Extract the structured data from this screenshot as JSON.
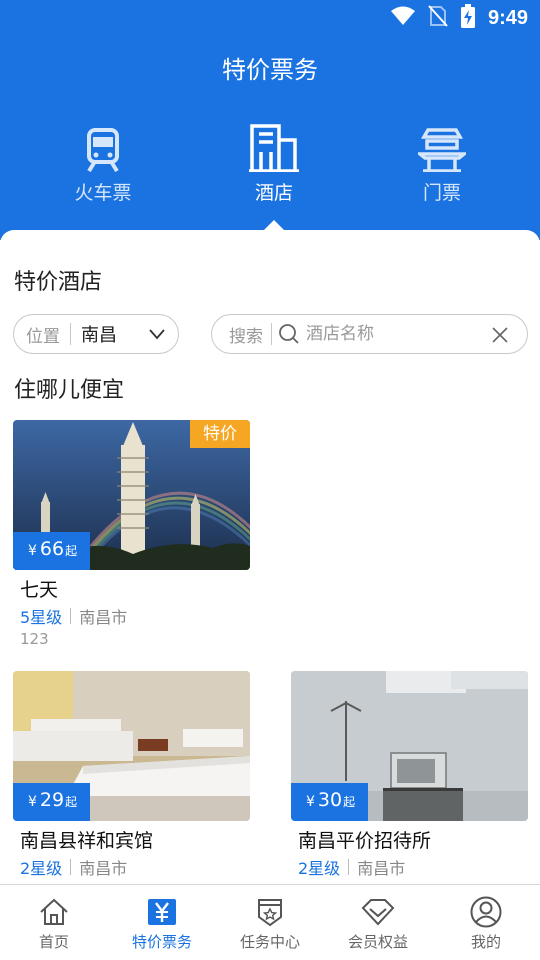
{
  "status_bar": {
    "time": "9:49"
  },
  "header": {
    "title": "特价票务",
    "tabs": [
      {
        "label": "火车票",
        "icon": "train-icon",
        "active": false
      },
      {
        "label": "酒店",
        "icon": "hotel-building-icon",
        "active": true
      },
      {
        "label": "门票",
        "icon": "gate-ticket-icon",
        "active": false
      }
    ]
  },
  "section_title": "特价酒店",
  "filter": {
    "location_label": "位置",
    "location_value": "南昌"
  },
  "search": {
    "label": "搜索",
    "placeholder": "酒店名称"
  },
  "subsection_title": "住哪儿便宜",
  "hotels": [
    {
      "name": "七天",
      "price_currency": "¥",
      "price": "66",
      "price_suffix": "起",
      "star": "5星级",
      "city": "南昌市",
      "extra": "123",
      "badge": "特价",
      "photo": "pagoda-rainbow"
    },
    {
      "name": "南昌县祥和宾馆",
      "price_currency": "¥",
      "price": "29",
      "price_suffix": "起",
      "star": "2星级",
      "city": "南昌市",
      "photo": "hotel-room-beds"
    },
    {
      "name": "南昌平价招待所",
      "price_currency": "¥",
      "price": "30",
      "price_suffix": "起",
      "star": "2星级",
      "city": "南昌市",
      "photo": "hotel-room-tv"
    }
  ],
  "bottom_nav": [
    {
      "label": "首页",
      "icon": "home-icon",
      "active": false
    },
    {
      "label": "特价票务",
      "icon": "yen-ticket-icon",
      "active": true
    },
    {
      "label": "任务中心",
      "icon": "task-badge-icon",
      "active": false
    },
    {
      "label": "会员权益",
      "icon": "diamond-icon",
      "active": false
    },
    {
      "label": "我的",
      "icon": "user-icon",
      "active": false
    }
  ],
  "colors": {
    "primary": "#1a73e0",
    "badge": "#f5a623",
    "text": "#222222",
    "muted": "#999999"
  }
}
